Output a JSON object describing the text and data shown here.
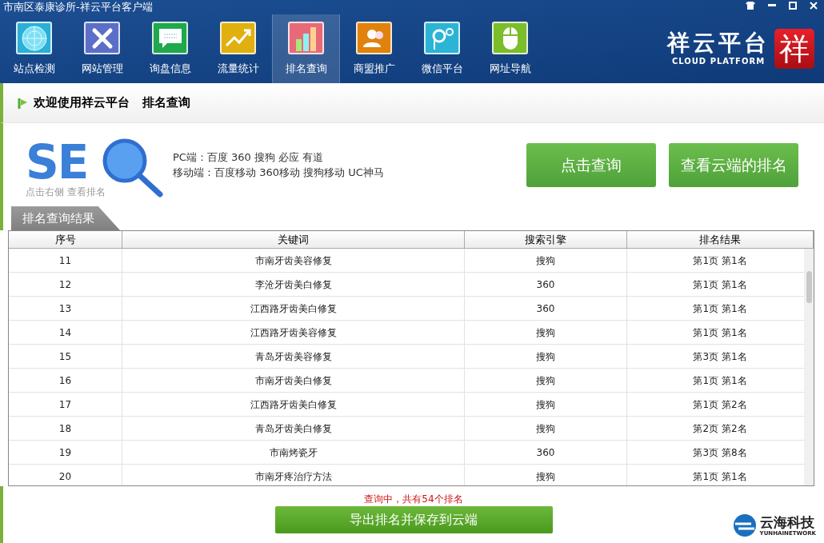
{
  "window": {
    "title": "市南区泰康诊所-祥云平台客户端"
  },
  "nav": [
    {
      "label": "站点检测",
      "kind": "radar",
      "selected": false
    },
    {
      "label": "网站管理",
      "kind": "tools",
      "selected": false
    },
    {
      "label": "询盘信息",
      "kind": "chat",
      "selected": false
    },
    {
      "label": "流量统计",
      "kind": "trend",
      "selected": false
    },
    {
      "label": "排名查询",
      "kind": "bars",
      "selected": true
    },
    {
      "label": "商盟推广",
      "kind": "people",
      "selected": false
    },
    {
      "label": "微信平台",
      "kind": "wechat",
      "selected": false
    },
    {
      "label": "网址导航",
      "kind": "mouse",
      "selected": false
    }
  ],
  "brand": {
    "name": "祥云平台",
    "subtitle": "CLOUD PLATFORM",
    "mark": "祥"
  },
  "breadcrumb": [
    "欢迎使用祥云平台",
    "排名查询"
  ],
  "seo": {
    "logo": "SE",
    "caption": "点击右侧 查看排名",
    "lines": [
      "PC端：百度 360 搜狗 必应 有道",
      "移动端：百度移动 360移动 搜狗移动 UC神马"
    ]
  },
  "buttons": [
    "点击查询",
    "查看云端的排名"
  ],
  "results_tab": "排名查询结果",
  "table": {
    "columns": [
      "序号",
      "关键词",
      "搜索引擎",
      "排名结果"
    ],
    "rows": [
      [
        "11",
        "市南牙齿美容修复",
        "搜狗",
        "第1页 第1名"
      ],
      [
        "12",
        "李沧牙齿美白修复",
        "360",
        "第1页 第1名"
      ],
      [
        "13",
        "江西路牙齿美白修复",
        "360",
        "第1页 第1名"
      ],
      [
        "14",
        "江西路牙齿美容修复",
        "搜狗",
        "第1页 第1名"
      ],
      [
        "15",
        "青岛牙齿美容修复",
        "搜狗",
        "第3页 第1名"
      ],
      [
        "16",
        "市南牙齿美白修复",
        "搜狗",
        "第1页 第1名"
      ],
      [
        "17",
        "江西路牙齿美白修复",
        "搜狗",
        "第1页 第2名"
      ],
      [
        "18",
        "青岛牙齿美白修复",
        "搜狗",
        "第2页 第2名"
      ],
      [
        "19",
        "市南烤瓷牙",
        "360",
        "第3页 第8名"
      ],
      [
        "20",
        "市南牙疼治疗方法",
        "搜狗",
        "第1页 第1名"
      ]
    ]
  },
  "status": "查询中，共有54个排名",
  "export_button": "导出排名并保存到云端",
  "footer_logo": {
    "name": "云海科技",
    "subtitle": "YUNHAINETWORK"
  }
}
